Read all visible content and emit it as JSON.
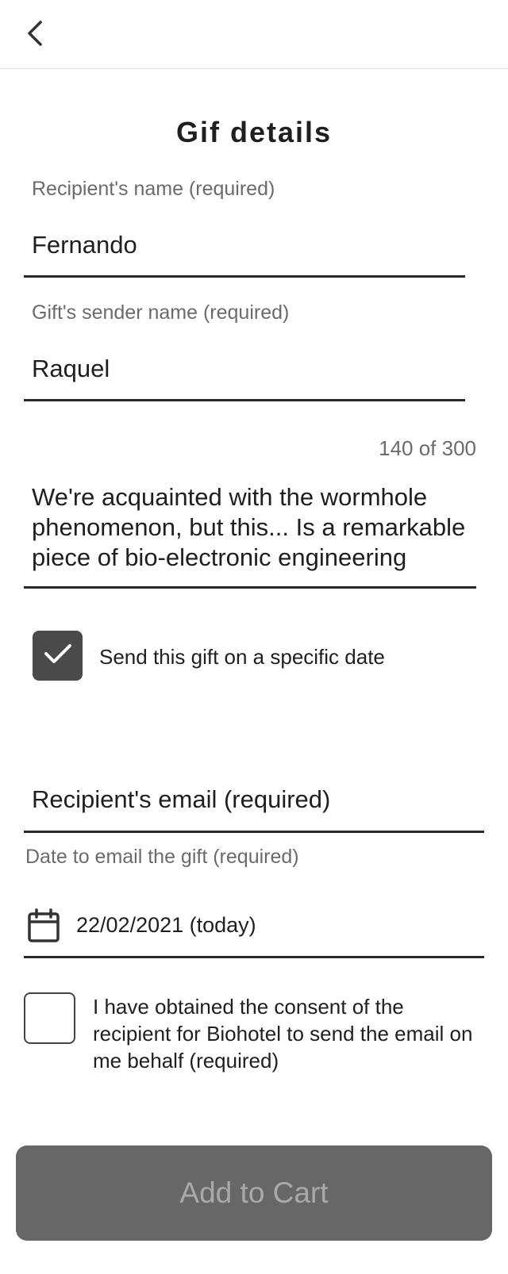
{
  "header": {
    "back_icon": "chevron-left-icon"
  },
  "form": {
    "title": "Gif details",
    "recipient_name": {
      "label": "Recipient's name (required)",
      "value": "Fernando"
    },
    "sender_name": {
      "label": "Gift's sender name (required)",
      "value": "Raquel"
    },
    "message": {
      "counter": "140 of 300",
      "value": "We're acquainted with the wormhole phenomenon, but this... Is a remarkable piece of bio-electronic engineering"
    },
    "specific_date": {
      "checked": true,
      "label": "Send this gift on a specific date"
    },
    "recipient_email": {
      "placeholder": "Recipient's email (required)"
    },
    "send_date": {
      "label": "Date to email the gift (required)",
      "value": "22/02/2021 (today)",
      "icon": "calendar-icon"
    },
    "consent": {
      "checked": false,
      "label": "I have obtained the consent of the recipient for Biohotel to send the email on me behalf (required)"
    },
    "submit_label": "Add to Cart"
  },
  "colors": {
    "text": "#1f1f1f",
    "muted": "#6b6b6b",
    "checkbox_fill": "#4a4a4a",
    "button_bg": "#676767",
    "button_text": "#a9a9a9"
  }
}
